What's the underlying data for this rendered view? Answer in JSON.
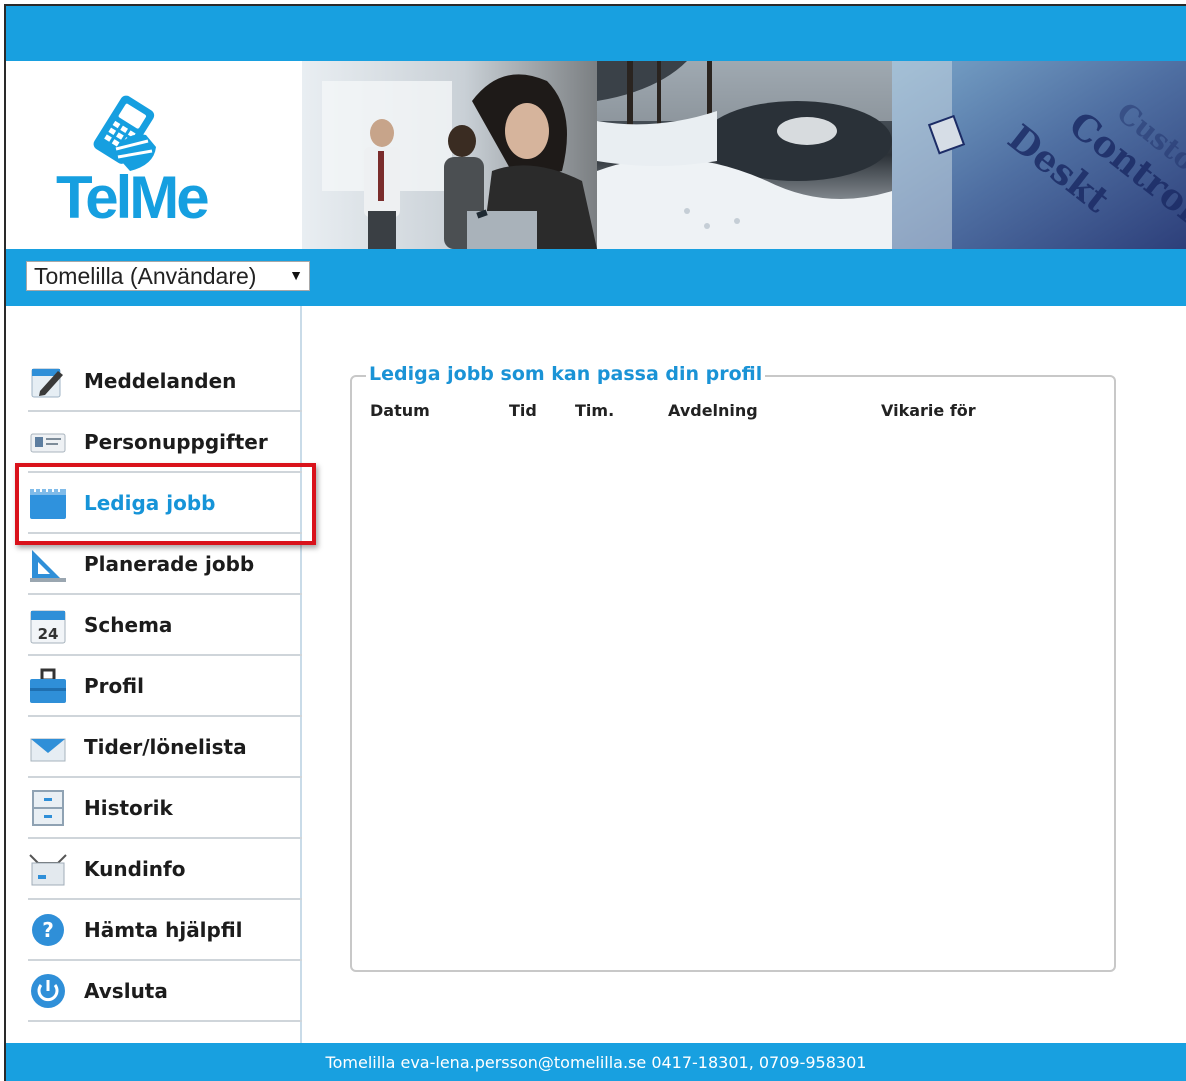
{
  "logo": {
    "text": "TelMe",
    "icon": "phone-hand-icon"
  },
  "user_select": {
    "value": "Tomelilla (Användare)",
    "caret": "▼"
  },
  "nav": [
    {
      "label": "Meddelanden",
      "icon": "notepad-pen-icon"
    },
    {
      "label": "Personuppgifter",
      "icon": "id-card-icon"
    },
    {
      "label": "Lediga jobb",
      "icon": "calendar-pad-icon",
      "active": true
    },
    {
      "label": "Planerade jobb",
      "icon": "set-square-icon"
    },
    {
      "label": "Schema",
      "icon": "calendar-24-icon"
    },
    {
      "label": "Profil",
      "icon": "briefcase-icon"
    },
    {
      "label": "Tider/lönelista",
      "icon": "envelope-icon"
    },
    {
      "label": "Historik",
      "icon": "file-cabinet-icon"
    },
    {
      "label": "Kundinfo",
      "icon": "inbox-tray-icon"
    },
    {
      "label": "Hämta hjälpfil",
      "icon": "help-icon"
    },
    {
      "label": "Avsluta",
      "icon": "power-icon"
    }
  ],
  "panel": {
    "title": "Lediga jobb som kan passa din profil",
    "columns": [
      "Datum",
      "Tid",
      "Tim.",
      "Avdelning",
      "Vikarie för"
    ]
  },
  "footer": {
    "text": "Tomelilla eva-lena.persson@tomelilla.se 0417-18301, 0709-958301"
  },
  "colors": {
    "brand_blue": "#18a0e0",
    "active_text": "#1694d8",
    "highlight_red": "#d9121b"
  }
}
